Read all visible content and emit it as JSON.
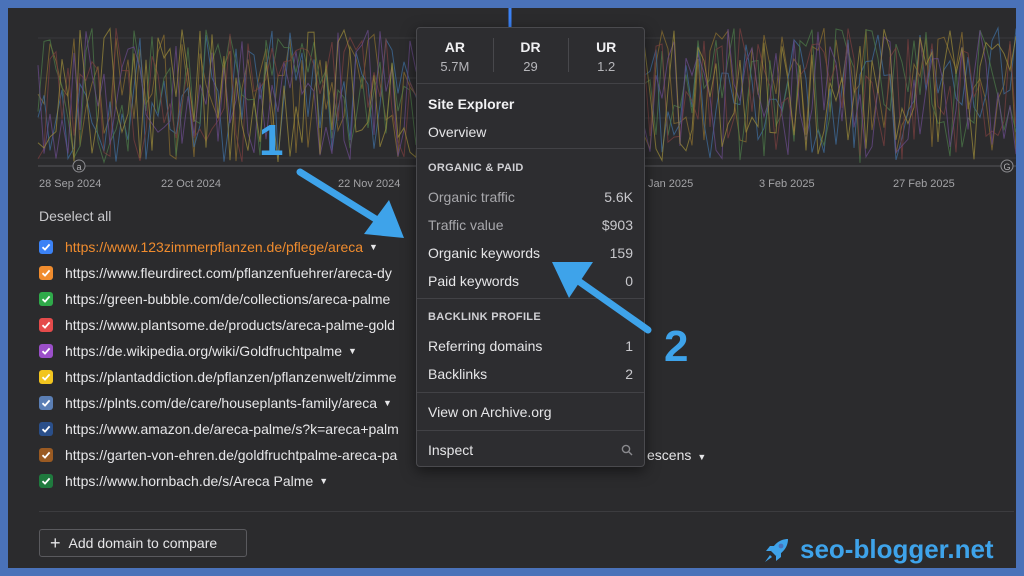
{
  "chart": {
    "x_ticks": [
      "28 Sep 2024",
      "22 Oct 2024",
      "22 Nov 2024",
      "Jan 2025",
      "3 Feb 2025",
      "27 Feb 2025"
    ],
    "marker_left": "a",
    "marker_right": "G"
  },
  "deselect_label": "Deselect all",
  "urls": [
    {
      "text": "https://www.123zimmerpflanzen.de/pflege/areca",
      "color": "#3b82f6",
      "active": true,
      "caret": true
    },
    {
      "text": "https://www.fleurdirect.com/pflanzenfuehrer/areca-dy",
      "color": "#f08c2e",
      "caret": false
    },
    {
      "text": "https://green-bubble.com/de/collections/areca-palme",
      "color": "#2faa4a",
      "caret": false
    },
    {
      "text": "https://www.plantsome.de/products/areca-palme-gold",
      "color": "#e44b4b",
      "caret": false
    },
    {
      "text": "https://de.wikipedia.org/wiki/Goldfruchtpalme",
      "color": "#9b4fc9",
      "caret": true
    },
    {
      "text": "https://plantaddiction.de/pflanzen/pflanzenwelt/zimme",
      "color": "#f2c51f",
      "caret": false
    },
    {
      "text": "https://plnts.com/de/care/houseplants-family/areca",
      "color": "#5b7fb5",
      "caret": true
    },
    {
      "text": "https://www.amazon.de/areca-palme/s?k=areca+palm",
      "color": "#2a4f8a",
      "caret": false
    },
    {
      "text": "https://garten-von-ehren.de/goldfruchtpalme-areca-pa",
      "color": "#9a5a22",
      "caret": false,
      "tail": "escens"
    },
    {
      "text": "https://www.hornbach.de/s/Areca Palme",
      "color": "#1f7a3e",
      "caret": true
    }
  ],
  "add_domain_label": "Add domain to compare",
  "popup": {
    "metrics": [
      {
        "label": "AR",
        "value": "5.7M"
      },
      {
        "label": "DR",
        "value": "29"
      },
      {
        "label": "UR",
        "value": "1.2"
      }
    ],
    "site_explorer": "Site Explorer",
    "overview": "Overview",
    "organic_paid_heading": "ORGANIC & PAID",
    "organic_traffic": {
      "label": "Organic traffic",
      "value": "5.6K"
    },
    "traffic_value": {
      "label": "Traffic value",
      "value": "$903"
    },
    "organic_keywords": {
      "label": "Organic keywords",
      "value": "159"
    },
    "paid_keywords": {
      "label": "Paid keywords",
      "value": "0"
    },
    "backlink_heading": "BACKLINK PROFILE",
    "referring_domains": {
      "label": "Referring domains",
      "value": "1"
    },
    "backlinks": {
      "label": "Backlinks",
      "value": "2"
    },
    "archive": "View on Archive.org",
    "inspect": "Inspect"
  },
  "annotations": {
    "one": "1",
    "two": "2"
  },
  "brand": "seo-blogger.net"
}
